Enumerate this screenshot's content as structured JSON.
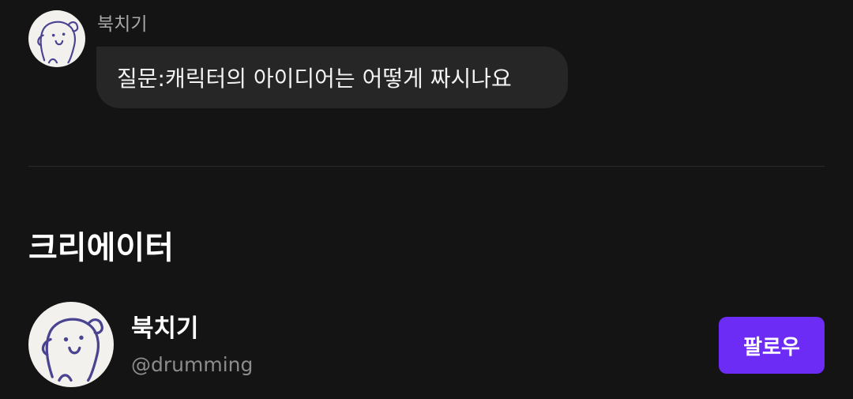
{
  "message": {
    "author": "북치기",
    "text": "질문:캐릭터의 아이디어는 어떻게 짜시나요"
  },
  "creator_section": {
    "title": "크리에이터",
    "creator": {
      "name": "북치기",
      "handle": "@drumming",
      "follow_label": "팔로우"
    }
  },
  "colors": {
    "background": "#141414",
    "bubble": "#262626",
    "accent": "#6d2cf5"
  },
  "icons": {
    "avatar": "ghost-doodle-avatar-icon"
  }
}
